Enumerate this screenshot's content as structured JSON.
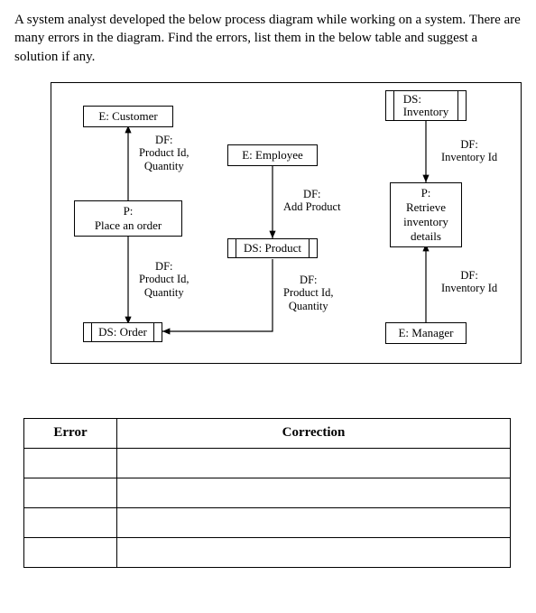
{
  "intro": "A system analyst developed the below process diagram while working on a system. There are many errors in the diagram. Find the errors, list them in the below table and suggest a solution if any.",
  "diagram": {
    "e_customer": "E: Customer",
    "e_employee": "E: Employee",
    "e_manager": "E: Manager",
    "ds_inventory": "DS:\nInventory",
    "ds_product": "DS: Product",
    "ds_order": "DS: Order",
    "p_place_order": "P:\nPlace an order",
    "p_retrieve": "P:\nRetrieve\ninventory\ndetails",
    "df_prodqty1": "DF:\nProduct Id,\nQuantity",
    "df_prodqty2": "DF:\nProduct Id,\nQuantity",
    "df_prodqty3": "DF:\nProduct Id,\nQuantity",
    "df_addproduct": "DF:\nAdd Product",
    "df_inv1": "DF:\nInventory Id",
    "df_inv2": "DF:\nInventory Id"
  },
  "table": {
    "error_header": "Error",
    "correction_header": "Correction"
  },
  "chart_data": {
    "type": "diagram",
    "notation": "DFD-like (Entities E:, Processes P:, Data Stores DS:, Data Flows DF:)",
    "nodes": [
      {
        "id": "E_Customer",
        "kind": "entity",
        "label": "E: Customer"
      },
      {
        "id": "E_Employee",
        "kind": "entity",
        "label": "E: Employee"
      },
      {
        "id": "E_Manager",
        "kind": "entity",
        "label": "E: Manager"
      },
      {
        "id": "P_PlaceOrder",
        "kind": "process",
        "label": "P: Place an order"
      },
      {
        "id": "P_RetrieveInventory",
        "kind": "process",
        "label": "P: Retrieve inventory details"
      },
      {
        "id": "DS_Inventory",
        "kind": "datastore",
        "label": "DS: Inventory"
      },
      {
        "id": "DS_Product",
        "kind": "datastore",
        "label": "DS: Product"
      },
      {
        "id": "DS_Order",
        "kind": "datastore",
        "label": "DS: Order"
      }
    ],
    "edges": [
      {
        "from": "P_PlaceOrder",
        "to": "E_Customer",
        "label": "DF: Product Id, Quantity"
      },
      {
        "from": "P_PlaceOrder",
        "to": "DS_Order",
        "label": "DF: Product Id, Quantity"
      },
      {
        "from": "E_Employee",
        "to": "DS_Product",
        "label": "DF: Add Product"
      },
      {
        "from": "DS_Product",
        "to": "DS_Order",
        "label": "DF: Product Id, Quantity"
      },
      {
        "from": "DS_Inventory",
        "to": "P_RetrieveInventory",
        "label": "DF: Inventory Id"
      },
      {
        "from": "E_Manager",
        "to": "P_RetrieveInventory",
        "label": "DF: Inventory Id"
      }
    ]
  }
}
